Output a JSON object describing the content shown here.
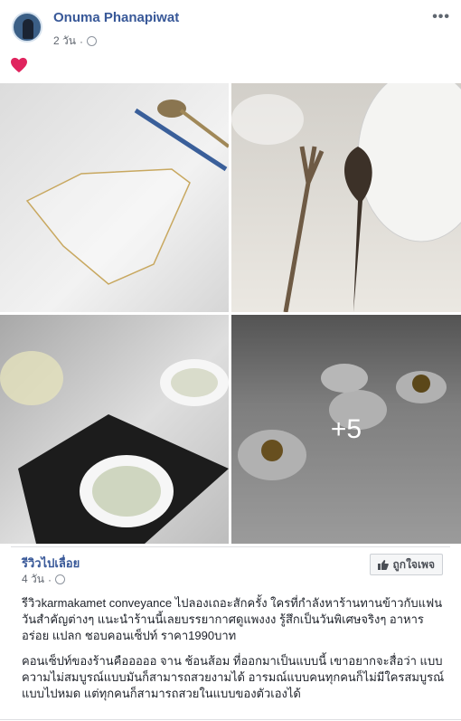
{
  "post": {
    "author": "Onuma Phanapiwat",
    "time": "2 วัน",
    "more_label": "•••"
  },
  "media": {
    "more_count": "+5"
  },
  "shared": {
    "page_name": "รีวิวไปเลื่อย",
    "time": "4 วัน",
    "like_button": "ถูกใจเพจ",
    "paragraph1": "รีวิวkarmakamet conveyance ไปลองเถอะสักครั้ง ใครที่กำลังหาร้านทานข้าวกับแฟน วันสำคัญต่างๆ แนะนำร้านนี้เลยบรรยากาศดูแพงงง รู้สึกเป็นวันพิเศษจริงๆ อาหารอร่อย แปลก ชอบคอนเซ็ปท์ ราคา1990บาท",
    "paragraph2": "คอนเซ็ปท์ของร้านคือออออ จาน ช้อนส้อม ที่ออกมาเป็นแบบนี้ เขาอยากจะสื่อว่า แบบ ความไม่สมบูรณ์แบบมันก็สามารถสวยงามได้ อารมณ์แบบคนทุกคนก็ไม่มีใครสมบูรณ์แบบไปหมด แต่ทุกคนก็สามารถสวยในแบบของตัวเองได้"
  },
  "colors": {
    "link": "#385898",
    "heart": "#e0245e"
  }
}
